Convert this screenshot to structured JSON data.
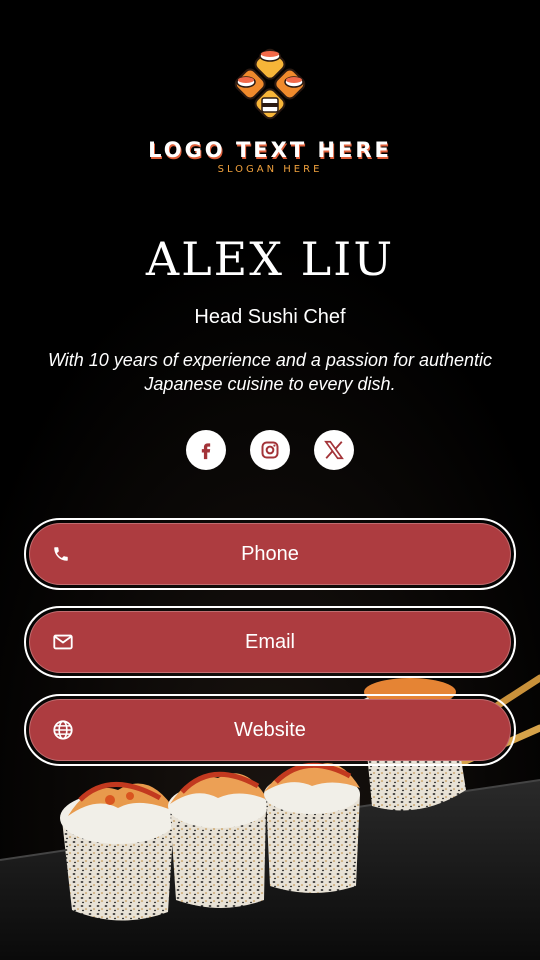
{
  "logo": {
    "text": "LOGO TEXT HERE",
    "slogan": "SLOGAN HERE"
  },
  "profile": {
    "name": "ALEX LIU",
    "title": "Head Sushi Chef",
    "bio": "With 10 years of experience and a passion for authentic Japanese cuisine to every dish."
  },
  "socials": [
    {
      "network": "facebook",
      "icon": "facebook-icon"
    },
    {
      "network": "instagram",
      "icon": "instagram-icon"
    },
    {
      "network": "x",
      "icon": "x-icon"
    }
  ],
  "buttons": {
    "phone": {
      "label": "Phone",
      "icon": "phone-icon"
    },
    "email": {
      "label": "Email",
      "icon": "mail-icon"
    },
    "website": {
      "label": "Website",
      "icon": "globe-icon"
    }
  },
  "colors": {
    "background": "#000000",
    "button": "#ad3c40",
    "accent": "#f0a13d",
    "icon": "#a33338"
  }
}
